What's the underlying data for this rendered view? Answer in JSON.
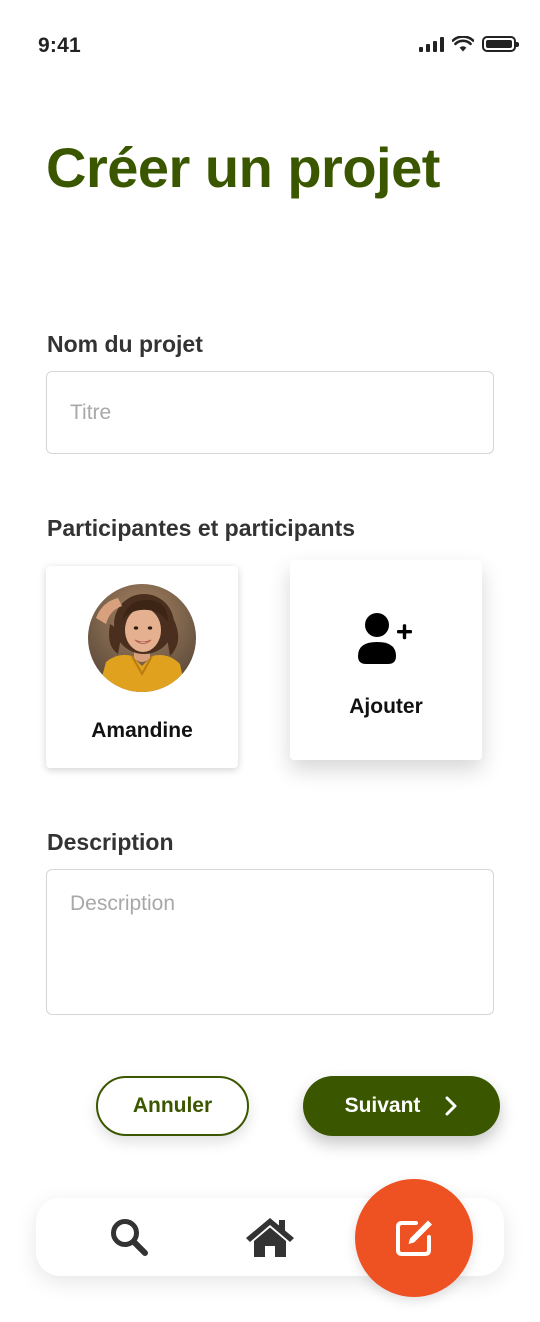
{
  "status_bar": {
    "time": "9:41"
  },
  "page": {
    "title": "Créer un projet"
  },
  "project_name": {
    "label": "Nom du projet",
    "placeholder": "Titre",
    "value": ""
  },
  "participants": {
    "label": "Participantes et participants",
    "people": [
      {
        "name": "Amandine"
      }
    ],
    "add_label": "Ajouter"
  },
  "description": {
    "label": "Description",
    "placeholder": "Description",
    "value": ""
  },
  "actions": {
    "cancel_label": "Annuler",
    "next_label": "Suivant"
  },
  "bottom_nav": {
    "items": [
      {
        "icon": "search-icon"
      },
      {
        "icon": "home-icon"
      },
      {
        "icon": "edit-icon",
        "active": true
      }
    ]
  },
  "colors": {
    "brand_green": "#3a5700",
    "fab_orange": "#ee5122",
    "text_dark": "#333333",
    "placeholder": "#a8a8a8"
  }
}
